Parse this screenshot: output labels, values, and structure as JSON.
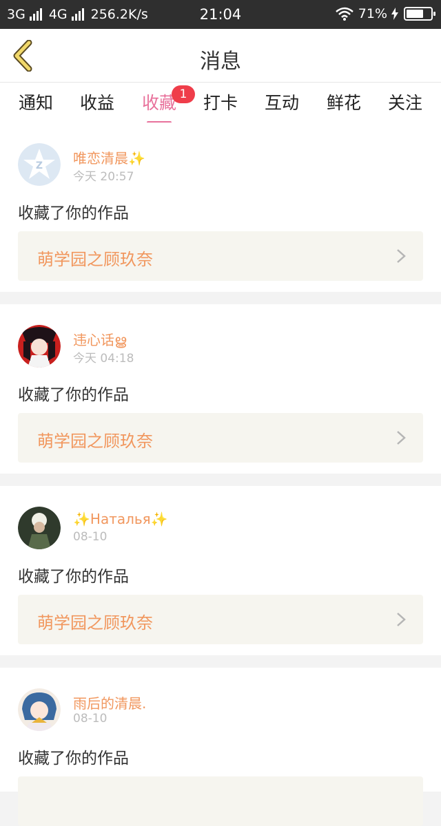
{
  "status_bar": {
    "network1": "3G",
    "network2": "4G",
    "speed": "256.2K/s",
    "time": "21:04",
    "battery": "71%",
    "battery_level": 0.71
  },
  "header": {
    "title": "消息"
  },
  "tabs": [
    {
      "label": "通知"
    },
    {
      "label": "收益"
    },
    {
      "label": "收藏",
      "badge": "1",
      "active": true
    },
    {
      "label": "打卡"
    },
    {
      "label": "互动"
    },
    {
      "label": "鲜花"
    },
    {
      "label": "关注"
    }
  ],
  "items": [
    {
      "name": "唯恋清晨",
      "name_suffix": "✨",
      "time": "今天 20:57",
      "action": "收藏了你的作品",
      "work": "萌学园之顾玖奈"
    },
    {
      "name": "违心话ൠ",
      "time": "今天 04:18",
      "action": "收藏了你的作品",
      "work": "萌学园之顾玖奈"
    },
    {
      "name_prefix": "✨",
      "name": "Наталья",
      "name_suffix": "✨",
      "time": "08-10",
      "action": "收藏了你的作品",
      "work": "萌学园之顾玖奈"
    },
    {
      "name": "雨后的清晨.",
      "time": "08-10",
      "action": "收藏了你的作品",
      "work": ""
    }
  ],
  "colors": {
    "accent": "#e8719b",
    "name": "#f1975e",
    "badge": "#ef3d4a"
  }
}
